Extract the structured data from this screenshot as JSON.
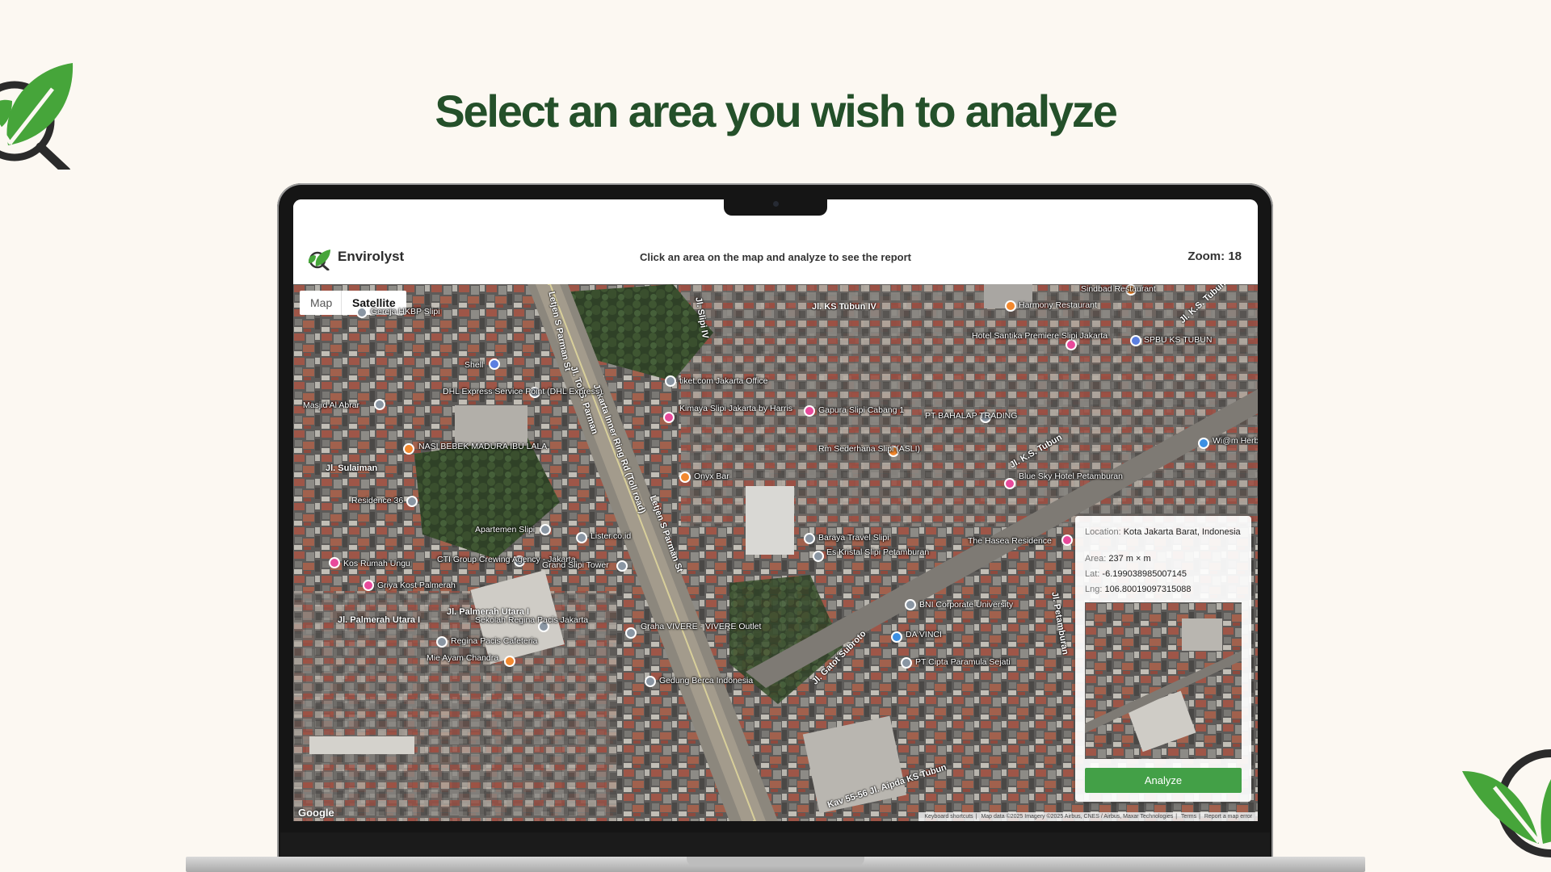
{
  "page": {
    "headline": "Select an area you wish to analyze",
    "brand_color": "#24502a",
    "accent_green": "#43a047"
  },
  "app": {
    "name": "Envirolyst",
    "instruction": "Click an area on the map and analyze to see the report",
    "zoom_label": "Zoom:",
    "zoom_value": "18"
  },
  "map": {
    "type_tabs": [
      {
        "label": "Map",
        "selected": false
      },
      {
        "label": "Satellite",
        "selected": true
      }
    ],
    "road_labels": [
      "Jl. KS Tubun IV",
      "Jl. K.S. Tubun",
      "Letjen S Parman St",
      "Jl. Tol S. Parman",
      "Jakarta Inner Ring Rd (Toll road)",
      "Letjen S Parman St",
      "Jl. K.S. Tubun",
      "Jl. Sulaiman",
      "Jl. Palmerah Utara I",
      "Jl. Palmerah Utara I",
      "Jl. Gatot Subroto",
      "Jl. Petamburan",
      "Jl. Slipi IV",
      "Kav 55-56 Jl. Aipda KS Tubun"
    ],
    "places": [
      {
        "name": "Harmony Restaurant",
        "icon": "restaurant-icon",
        "color": "#f2892f"
      },
      {
        "name": "Sindbad Restaurant",
        "icon": "restaurant-icon",
        "color": "#f2892f"
      },
      {
        "name": "Hotel Santika Premiere Slipi Jakarta",
        "icon": "hotel-icon",
        "color": "#e84a9b"
      },
      {
        "name": "SPBU KS TUBUN",
        "icon": "gas-station-icon",
        "color": "#5b7fe0"
      },
      {
        "name": "tiket.com Jakarta Office",
        "icon": "office-icon",
        "color": "#8a96a3"
      },
      {
        "name": "Kimaya Slipi Jakarta by Harris",
        "icon": "hotel-icon",
        "color": "#e84a9b"
      },
      {
        "name": "Gapura Slipi Cabang 1",
        "icon": "hotel-icon",
        "color": "#e84a9b"
      },
      {
        "name": "PT BAHALAP TRADING",
        "icon": "office-icon",
        "color": "#8a96a3"
      },
      {
        "name": "Wi@m Herb",
        "icon": "shop-icon",
        "color": "#3d8fe3"
      },
      {
        "name": "DHL Express Service Point (DHL Express)",
        "icon": "office-icon",
        "color": "#8a96a3"
      },
      {
        "name": "Shell",
        "icon": "gas-station-icon",
        "color": "#5b7fe0"
      },
      {
        "name": "Masjid Al Abrar",
        "icon": "mosque-icon",
        "color": "#8a96a3"
      },
      {
        "name": "NASI BEBEK MADURA IBU LALA",
        "icon": "restaurant-icon",
        "color": "#f2892f"
      },
      {
        "name": "Rm Sederhana Slipi (ASLI)",
        "icon": "restaurant-icon",
        "color": "#f2892f"
      },
      {
        "name": "Blue Sky Hotel Petamburan",
        "icon": "hotel-icon",
        "color": "#e84a9b"
      },
      {
        "name": "Onyx Bar",
        "icon": "bar-icon",
        "color": "#f2892f"
      },
      {
        "name": "Residence 36",
        "icon": "office-icon",
        "color": "#8a96a3"
      },
      {
        "name": "Apartemen Slipi",
        "icon": "office-icon",
        "color": "#8a96a3"
      },
      {
        "name": "Lister.co.id",
        "icon": "office-icon",
        "color": "#8a96a3"
      },
      {
        "name": "CTI Group Crewing Agency - Jakarta",
        "icon": "office-icon",
        "color": "#8a96a3"
      },
      {
        "name": "Grand Slipi Tower",
        "icon": "office-icon",
        "color": "#8a96a3"
      },
      {
        "name": "Baraya Travel Slipi",
        "icon": "office-icon",
        "color": "#8a96a3"
      },
      {
        "name": "Es Kristal Slipi Petamburan",
        "icon": "office-icon",
        "color": "#8a96a3"
      },
      {
        "name": "The Hasea Residence",
        "icon": "hotel-icon",
        "color": "#e84a9b"
      },
      {
        "name": "Kos Rumah Ungu",
        "icon": "hotel-icon",
        "color": "#e84a9b"
      },
      {
        "name": "Griya Kost Palmerah",
        "icon": "hotel-icon",
        "color": "#e84a9b"
      },
      {
        "name": "BNI Corporate University",
        "icon": "school-icon",
        "color": "#8a96a3"
      },
      {
        "name": "Sekolah Regina Pacis Jakarta",
        "icon": "school-icon",
        "color": "#8a96a3"
      },
      {
        "name": "Regina Pacis Cafeteria",
        "icon": "office-icon",
        "color": "#8a96a3"
      },
      {
        "name": "Graha VIVERE - VIVERE Outlet",
        "icon": "office-icon",
        "color": "#8a96a3"
      },
      {
        "name": "DA VINCI",
        "icon": "shop-icon",
        "color": "#3d8fe3"
      },
      {
        "name": "Mie Ayam Chandra",
        "icon": "restaurant-icon",
        "color": "#f2892f"
      },
      {
        "name": "Gedung Berca Indonesia",
        "icon": "office-icon",
        "color": "#8a96a3"
      },
      {
        "name": "PT Cipta Paramula Sejati",
        "icon": "office-icon",
        "color": "#8a96a3"
      },
      {
        "name": "Gereja HKBP Slipi",
        "icon": "church-icon",
        "color": "#8a96a3"
      }
    ],
    "google_label": "Google",
    "footer": [
      "Keyboard shortcuts",
      "Map data ©2025 Imagery ©2025 Airbus, CNES / Airbus, Maxar Technologies",
      "Terms",
      "Report a map error"
    ]
  },
  "info_card": {
    "location_key": "Location:",
    "location_value": "Kota Jakarta Barat, Indonesia",
    "area_key": "Area:",
    "area_value": "237 m × m",
    "lat_key": "Lat:",
    "lat_value": "-6.199038985007145",
    "lng_key": "Lng:",
    "lng_value": "106.80019097315088",
    "analyze_label": "Analyze"
  }
}
